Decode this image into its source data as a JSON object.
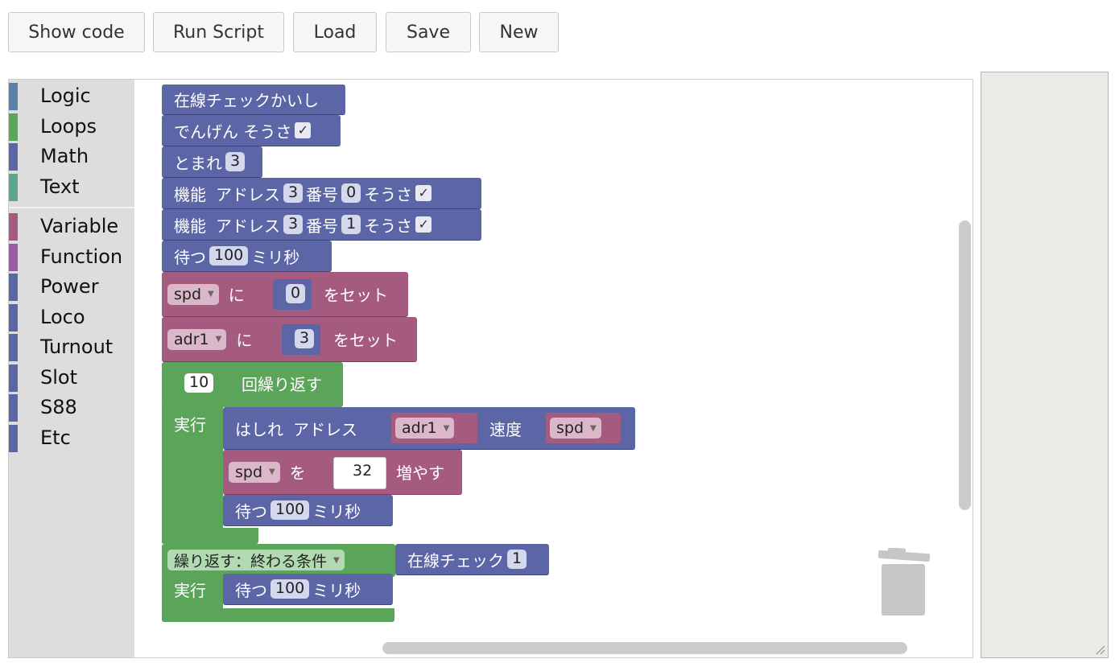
{
  "toolbar": {
    "show_code": "Show code",
    "run_script": "Run Script",
    "load": "Load",
    "save": "Save",
    "new": "New"
  },
  "toolbox": {
    "categories": [
      {
        "label": "Logic",
        "color": "#5b80a5"
      },
      {
        "label": "Loops",
        "color": "#5ba55b"
      },
      {
        "label": "Math",
        "color": "#5b67a5"
      },
      {
        "label": "Text",
        "color": "#5ba58c"
      },
      {
        "label": "Variable",
        "color": "#a55b80"
      },
      {
        "label": "Function",
        "color": "#995ba5"
      },
      {
        "label": "Power",
        "color": "#5b67a5"
      },
      {
        "label": "Loco",
        "color": "#5b67a5"
      },
      {
        "label": "Turnout",
        "color": "#5b67a5"
      },
      {
        "label": "Slot",
        "color": "#5b67a5"
      },
      {
        "label": "S88",
        "color": "#5b67a5"
      },
      {
        "label": "Etc",
        "color": "#5b67a5"
      }
    ]
  },
  "colors": {
    "blue_block": "#5c66a6",
    "pink_block": "#a55b80",
    "green_block": "#5ba55b",
    "toolbox_bg": "#dddddd",
    "output_bg": "#ebeae4"
  },
  "blocks": {
    "b1": {
      "label": "在線チェックかいし"
    },
    "b2": {
      "label": "でんげん そうさ",
      "checked": "✓"
    },
    "b3": {
      "label": "とまれ",
      "value": "3"
    },
    "b4": {
      "kino": "機能",
      "address_label": "アドレス",
      "address": "3",
      "number_label": "番号",
      "number": "0",
      "operate": "そうさ",
      "checked": "✓"
    },
    "b5": {
      "kino": "機能",
      "address_label": "アドレス",
      "address": "3",
      "number_label": "番号",
      "number": "1",
      "operate": "そうさ",
      "checked": "✓"
    },
    "b6": {
      "wait": "待つ",
      "ms": "100",
      "unit": "ミリ秒"
    },
    "b7": {
      "var": "spd",
      "ni": "に",
      "value": "0",
      "set": "をセット"
    },
    "b8": {
      "var": "adr1",
      "ni": "に",
      "value": "3",
      "set": "をセット"
    },
    "repeat": {
      "count": "10",
      "label": "回繰り返す",
      "do": "実行"
    },
    "run": {
      "label": "はしれ",
      "address_label": "アドレス",
      "address_var": "adr1",
      "speed_label": "速度",
      "speed_var": "spd"
    },
    "inc": {
      "var": "spd",
      "wo": "を",
      "value": "32",
      "label": "増やす"
    },
    "wait_inner": {
      "wait": "待つ",
      "ms": "100",
      "unit": "ミリ秒"
    },
    "until": {
      "mode": "繰り返す：終わる条件",
      "do": "実行",
      "check_label": "在線チェック",
      "check_value": "1"
    },
    "wait_until": {
      "wait": "待つ",
      "ms": "100",
      "unit": "ミリ秒"
    }
  }
}
